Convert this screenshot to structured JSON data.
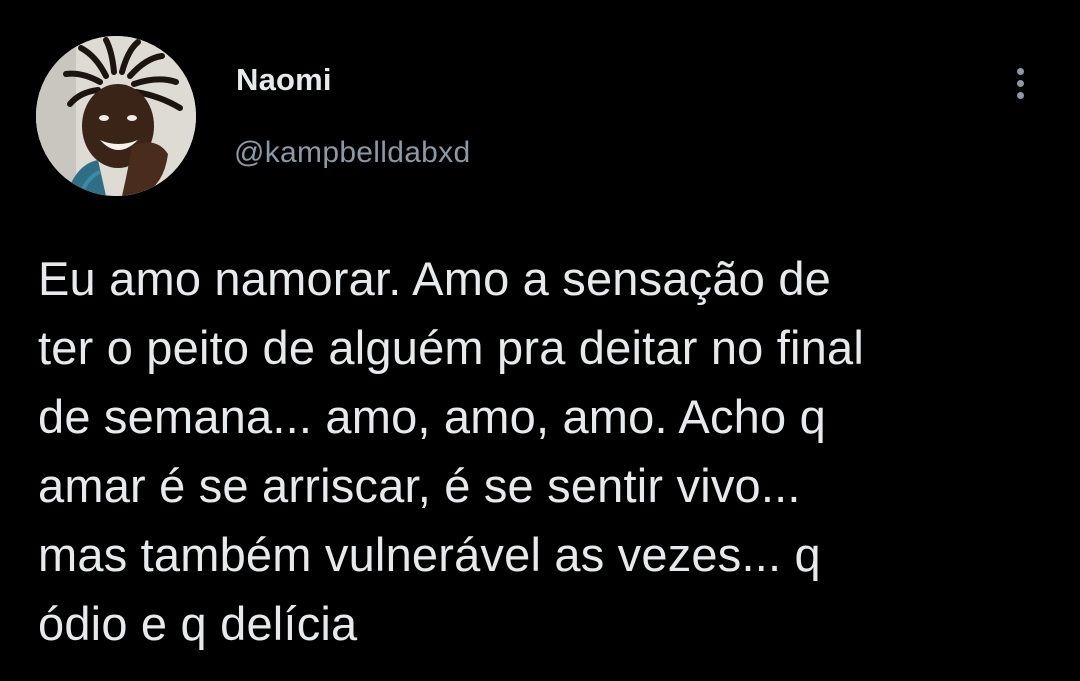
{
  "tweet": {
    "author": {
      "display_name": "Naomi",
      "handle": "@kampbelldabxd",
      "avatar_icon": "profile-photo"
    },
    "menu_icon": "more-vertical-icon",
    "text_lines": [
      "Eu amo namorar. Amo a sensação de",
      "ter o peito de alguém pra deitar no final",
      "de semana... amo, amo, amo. Acho q",
      "amar é se arriscar, é se sentir vivo...",
      "mas também vulnerável as vezes... q",
      "ódio e q delícia"
    ]
  },
  "colors": {
    "background": "#000000",
    "primary_text": "#e7e9ea",
    "secondary_text": "#8b98a5"
  }
}
